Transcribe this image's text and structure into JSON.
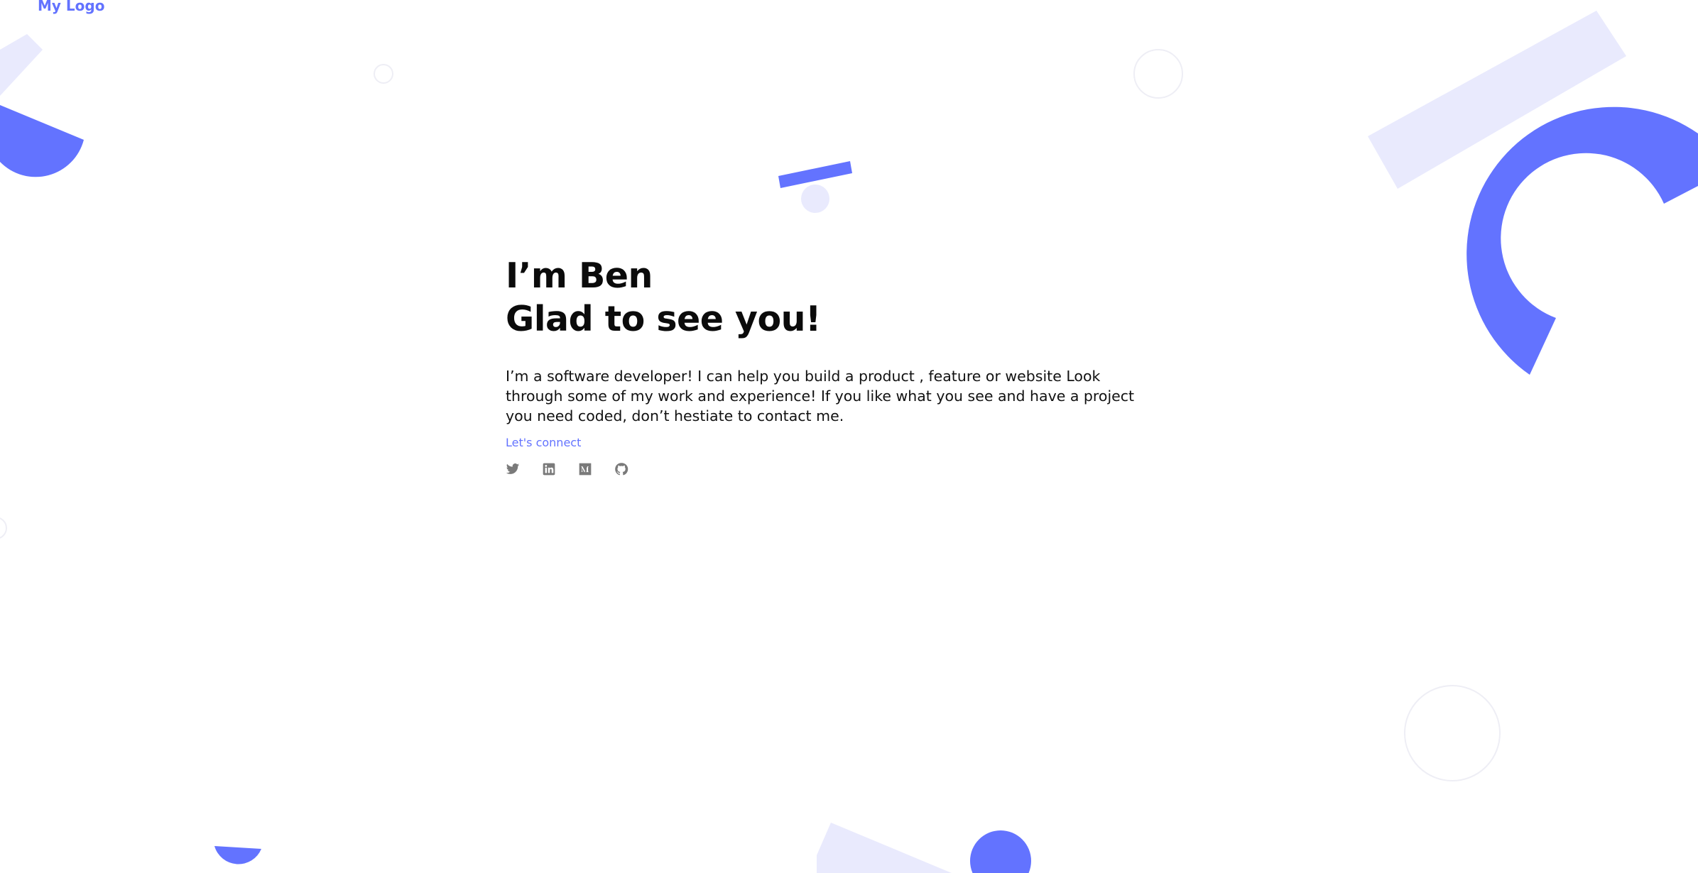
{
  "header": {
    "logo": "My Logo"
  },
  "hero": {
    "line1": "I’m Ben",
    "line2": "Glad to see you!",
    "description": "I’m a software developer! I can help you build a product , feature or website Look through some of my work and experience! If you like what you see and have a project you need coded, don’t hestiate to contact me.",
    "cta": "Let's connect"
  },
  "socials": [
    {
      "icon": "twitter-icon"
    },
    {
      "icon": "linkedin-icon"
    },
    {
      "icon": "medium-icon"
    },
    {
      "icon": "github-icon"
    }
  ],
  "colors": {
    "accent": "#6373ff",
    "accent_light": "#e9eafd",
    "outline": "#eeeef5",
    "icon": "#7a7a7a"
  }
}
